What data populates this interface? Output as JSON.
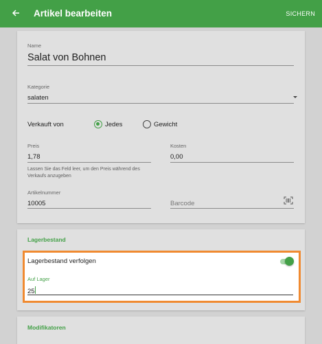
{
  "appbar": {
    "title": "Artikel bearbeiten",
    "save_label": "SICHERN",
    "back_icon": "arrow-left-icon",
    "color": "#43a047"
  },
  "form": {
    "name": {
      "label": "Name",
      "value": "Salat von Bohnen"
    },
    "category": {
      "label": "Kategorie",
      "value": "salaten"
    },
    "sold_by": {
      "label": "Verkauft von",
      "options": [
        {
          "label": "Jedes",
          "selected": true
        },
        {
          "label": "Gewicht",
          "selected": false
        }
      ]
    },
    "price": {
      "label": "Preis",
      "value": "1,78",
      "hint": "Lassen Sie das Feld leer, um den Preis während des Verkaufs anzugeben"
    },
    "cost": {
      "label": "Kosten",
      "value": "0,00"
    },
    "sku": {
      "label": "Artikelnummer",
      "value": "10005"
    },
    "barcode": {
      "placeholder": "Barcode",
      "icon": "barcode-scan-icon"
    }
  },
  "inventory": {
    "section_title": "Lagerbestand",
    "track_label": "Lagerbestand verfolgen",
    "track_enabled": true,
    "stock": {
      "label": "Auf Lager",
      "value": "25"
    }
  },
  "modifiers": {
    "section_title": "Modifikatoren"
  }
}
